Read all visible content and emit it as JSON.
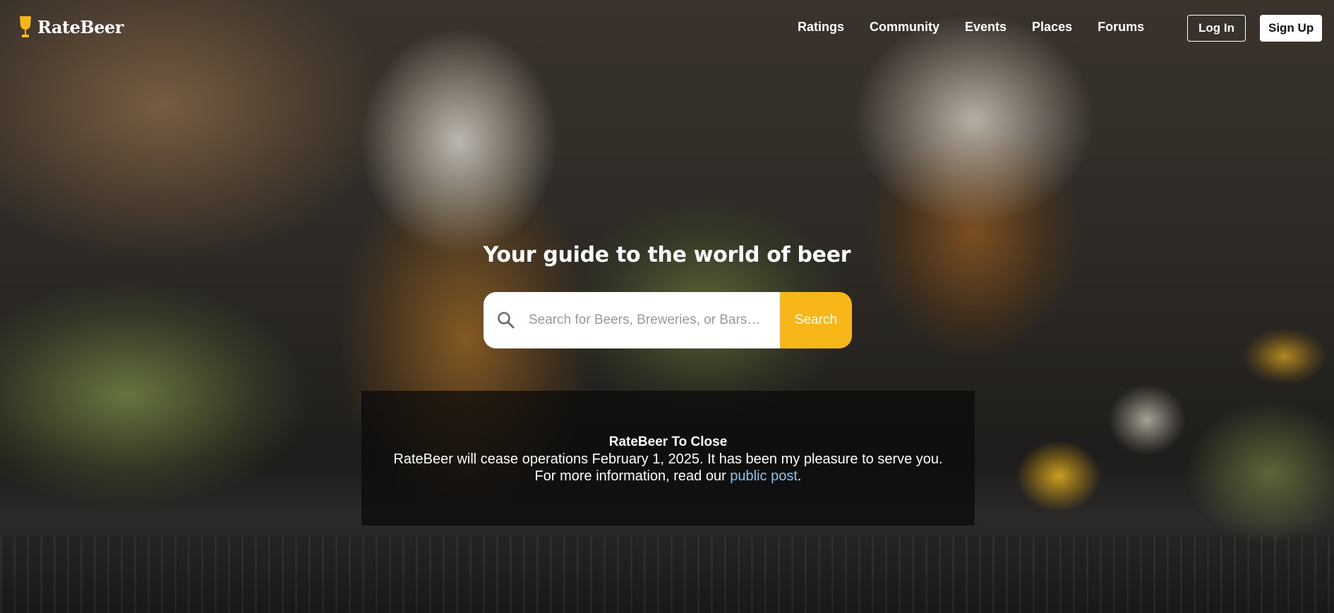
{
  "brand": {
    "name": "RateBeer",
    "logo_color": "#f7b718"
  },
  "nav": {
    "items": [
      {
        "label": "Ratings"
      },
      {
        "label": "Community"
      },
      {
        "label": "Events"
      },
      {
        "label": "Places"
      },
      {
        "label": "Forums"
      }
    ]
  },
  "auth": {
    "login_label": "Log In",
    "signup_label": "Sign Up"
  },
  "hero": {
    "tagline": "Your guide to the world of beer",
    "search": {
      "placeholder": "Search for Beers, Breweries, or Bars…",
      "button_label": "Search",
      "icon": "search-icon",
      "button_color": "#f7b718"
    }
  },
  "notice": {
    "title": "RateBeer To Close",
    "line1": "RateBeer will cease operations February 1, 2025. It has been my pleasure to serve you.",
    "line2_prefix": "For more information, read our ",
    "link_text": "public post",
    "line2_suffix": "."
  }
}
